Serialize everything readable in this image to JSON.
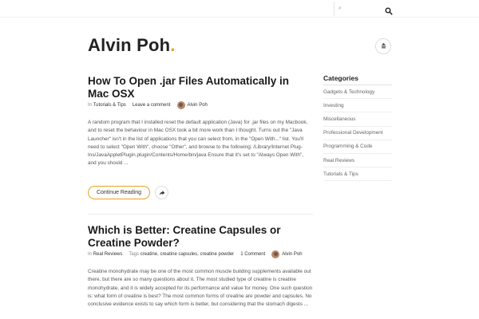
{
  "search": {
    "placeholder": "#"
  },
  "site": {
    "title": "Alvin Poh",
    "title_dot": "."
  },
  "posts": [
    {
      "title": "How To Open .jar Files Automatically in Mac OSX",
      "meta": {
        "in": "In",
        "category": "Tutorials & Tips",
        "comments": "Leave a comment",
        "author": "Alvin Poh"
      },
      "excerpt": "A random program that I installed reset the default application (Java) for .jar files on my Macbook, and to reset the behaviour in Mac OSX took a bit more work than I thought. Turns out the \"Java Launcher\" isn't in the list of applications that you can select from, in the \"Open With...\" list. You'll need to select \"Open With\", choose \"Other\", and browse to the following: /Library/Internet Plug-Ins/JavaAppletPlugin.plugin/Contents/Home/bin/java Ensure that it's set to \"Always Open With\", and you should ...",
      "read_more": "Continue Reading"
    },
    {
      "title": "Which is Better: Creatine Capsules or Creatine Powder?",
      "meta": {
        "in": "In",
        "category": "Real Reviews",
        "tags_label": "Tags",
        "tags": [
          "creatine",
          "creatine capsules",
          "creatine powder"
        ],
        "comments": "1 Comment",
        "author": "Alvin Poh"
      },
      "excerpt": "Creatine monohydrate may be one of the most common muscle building supplements available out there, but there are so many questions about it. The most studied type of creatine is creatine monohydrate, and it is widely accepted for its performance and value for money. One such question is: what form of creatine is best? The most common forms of creatine are powder and capsules. No conclusive evidence exists to say which form is better, but considering that the stomach digests ..."
    }
  ],
  "sidebar": {
    "heading": "Categories",
    "categories": [
      "Gadgets & Technology",
      "Investing",
      "Miscellaneous",
      "Professional Development",
      "Programming & Code",
      "Real Reviews",
      "Tutorials & Tips"
    ]
  },
  "colors": {
    "accent": "#e8a21f",
    "title": "#222222",
    "text": "#555555"
  },
  "icons": {
    "search": "search-icon",
    "menu": "menu-toggle-icon",
    "share": "share-icon"
  }
}
